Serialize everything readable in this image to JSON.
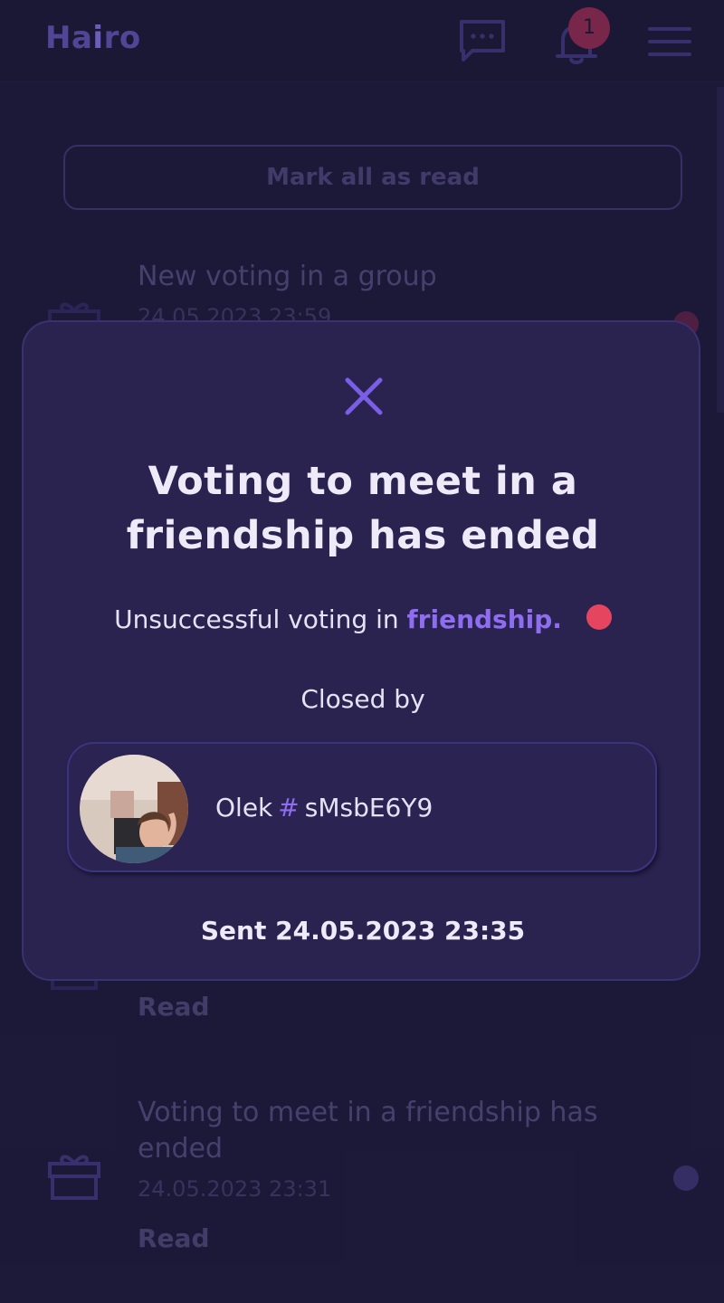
{
  "header": {
    "logo_prefix": "Ha",
    "logo_i": "i",
    "logo_suffix": "ro",
    "bell_badge_count": "1",
    "icons": [
      "chat-icon",
      "bell-icon",
      "menu-icon"
    ]
  },
  "list": {
    "mark_all_label": "Mark all as read",
    "items": [
      {
        "title": "New voting in a group",
        "date": "24.05.2023 23:59",
        "status": "",
        "unread": true
      },
      {
        "title": "",
        "date": "",
        "status": "Read",
        "unread": false
      },
      {
        "title": "Voting to meet in a friendship has ended",
        "date": "24.05.2023 23:31",
        "status": "Read",
        "unread": false
      }
    ]
  },
  "modal": {
    "title": "Voting to meet in a friendship has ended",
    "description_prefix": "Unsuccessful voting in",
    "description_link": "friendship.",
    "closed_by_label": "Closed by",
    "user": {
      "name": "Olek",
      "hash_symbol": "#",
      "tag": "sMsbE6Y9"
    },
    "sent_label": "Sent",
    "sent_datetime": "24.05.2023 23:35"
  },
  "colors": {
    "background": "#1e1a3b",
    "modal": "#2a2350",
    "accent": "#8e6df0",
    "alert_dot": "#e64560"
  }
}
